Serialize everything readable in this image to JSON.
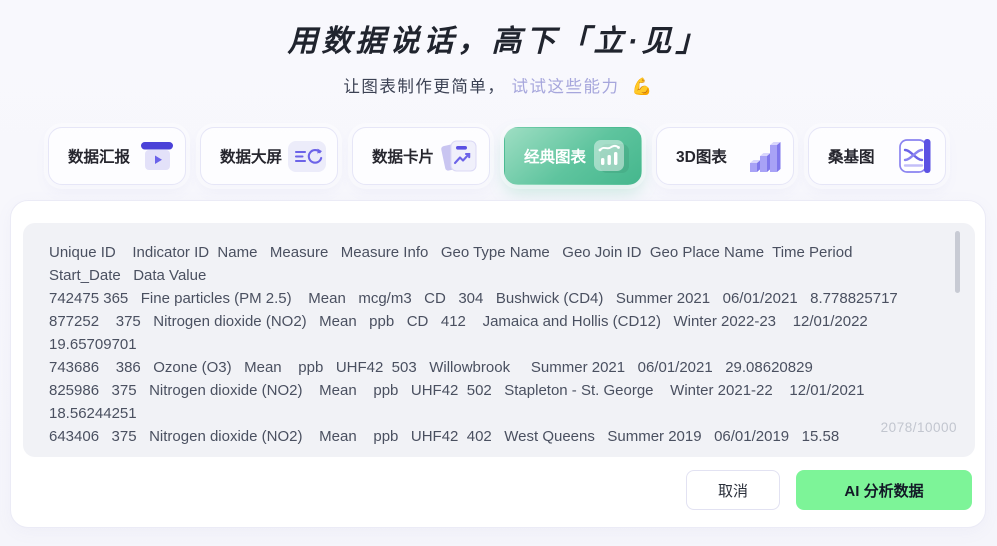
{
  "header": {
    "title": "用数据说话，高下「立·见」",
    "subtitle_prefix": "让图表制作更简单，",
    "subtitle_highlight": "试试这些能力",
    "subtitle_emoji": "💪"
  },
  "tabs": [
    {
      "label": "数据汇报",
      "icon": "presentation-icon",
      "selected": false
    },
    {
      "label": "数据大屏",
      "icon": "dashboard-refresh-icon",
      "selected": false
    },
    {
      "label": "数据卡片",
      "icon": "card-chart-icon",
      "selected": false
    },
    {
      "label": "经典图表",
      "icon": "classic-chart-icon",
      "selected": true
    },
    {
      "label": "3D图表",
      "icon": "bars-3d-icon",
      "selected": false
    },
    {
      "label": "桑基图",
      "icon": "sankey-icon",
      "selected": false
    }
  ],
  "editor": {
    "lines": [
      "Unique ID    Indicator ID  Name   Measure   Measure Info   Geo Type Name   Geo Join ID  Geo Place Name  Time Period",
      "Start_Date   Data Value",
      "742475 365   Fine particles (PM 2.5)    Mean   mcg/m3   CD   304   Bushwick (CD4)   Summer 2021   06/01/2021   8.778825717",
      "877252    375   Nitrogen dioxide (NO2)   Mean   ppb   CD   412    Jamaica and Hollis (CD12)   Winter 2022-23    12/01/2022",
      "19.65709701",
      "743686    386   Ozone (O3)   Mean    ppb   UHF42  503   Willowbrook     Summer 2021   06/01/2021   29.08620829",
      "825986   375   Nitrogen dioxide (NO2)    Mean    ppb   UHF42  502   Stapleton - St. George    Winter 2021-22    12/01/2021",
      "18.56244251",
      "643406   375   Nitrogen dioxide (NO2)    Mean    ppb   UHF42  402   West Queens   Summer 2019   06/01/2019   15.58"
    ],
    "char_count": "2078/10000"
  },
  "actions": {
    "cancel_label": "取消",
    "analyze_label": "AI 分析数据"
  },
  "colors": {
    "accent_green_button": "#7df498",
    "selected_tab_gradient_start": "#9edec3",
    "selected_tab_gradient_end": "#45b78d",
    "accent_purple": "#6c63e8",
    "subtitle_highlight": "#a6a6dc"
  }
}
